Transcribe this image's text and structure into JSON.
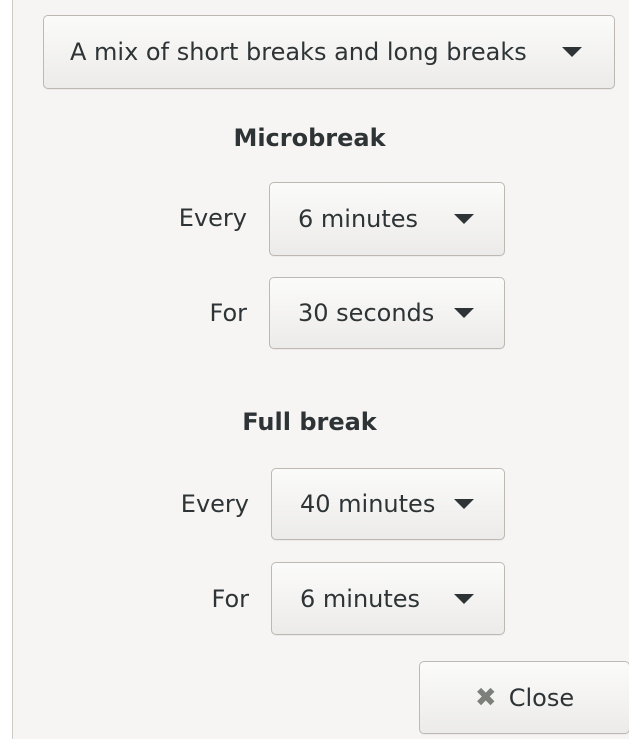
{
  "mode_select": {
    "value": "A mix of short breaks and long breaks"
  },
  "microbreak": {
    "title": "Microbreak",
    "every_label": "Every",
    "every_value": "6 minutes",
    "for_label": "For",
    "for_value": "30 seconds"
  },
  "full_break": {
    "title": "Full break",
    "every_label": "Every",
    "every_value": "40 minutes",
    "for_label": "For",
    "for_value": "6 minutes"
  },
  "close_button": {
    "icon": "close-icon",
    "glyph": "✖",
    "label": "Close"
  }
}
